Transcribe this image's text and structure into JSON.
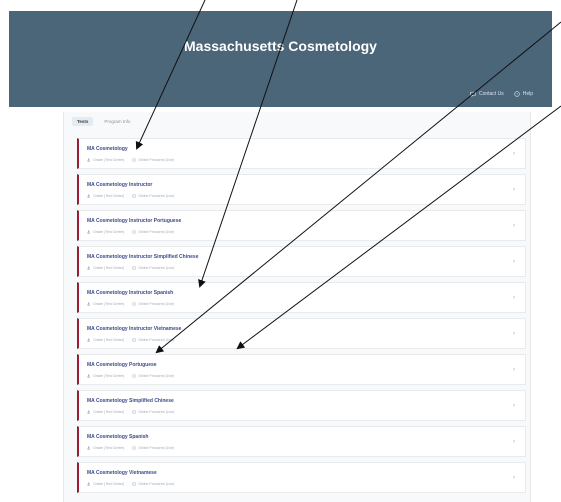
{
  "header": {
    "title": "Massachusetts Cosmetology",
    "contact_label": "Contact Us",
    "help_label": "Help"
  },
  "tabs": [
    {
      "label": "Tests",
      "active": true
    },
    {
      "label": "Program Info",
      "active": false
    }
  ],
  "meta_labels": {
    "onsite": "Onsite (Test Center)",
    "online": "Online Proctored (Live)"
  },
  "tests": [
    {
      "title": "MA Cosmetology"
    },
    {
      "title": "MA Cosmetology Instructor"
    },
    {
      "title": "MA Cosmetology Instructor Portuguese"
    },
    {
      "title": "MA Cosmetology Instructor Simplified Chinese"
    },
    {
      "title": "MA Cosmetology Instructor Spanish"
    },
    {
      "title": "MA Cosmetology Instructor Vietnamese"
    },
    {
      "title": "MA Cosmetology Portuguese"
    },
    {
      "title": "MA Cosmetology Simplified Chinese"
    },
    {
      "title": "MA Cosmetology Spanish"
    },
    {
      "title": "MA Cosmetology Vietnamese"
    }
  ],
  "colors": {
    "header_bg": "#4b6579",
    "accent_bar": "#9b1b30",
    "title_text": "#3b4a8a"
  }
}
